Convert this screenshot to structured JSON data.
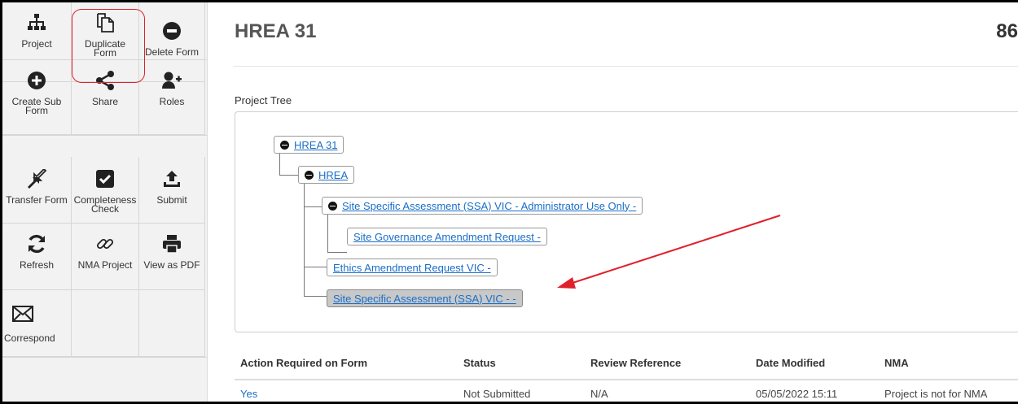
{
  "sidebar": {
    "project": "Project",
    "duplicate": "Duplicate\nForm",
    "delete": "Delete Form",
    "create_sub": "Create Sub\nForm",
    "share": "Share",
    "roles": "Roles",
    "transfer": "Transfer Form",
    "completeness": "Completeness\nCheck",
    "submit": "Submit",
    "refresh": "Refresh",
    "nma_project": "NMA Project",
    "view_pdf": "View as PDF",
    "correspond": "Correspond"
  },
  "header": {
    "title": "HREA 31",
    "number": "86"
  },
  "tree": {
    "label": "Project Tree",
    "nodes": [
      "HREA 31",
      "HREA",
      "Site Specific Assessment (SSA) VIC - Administrator Use Only -",
      "Site Governance Amendment Request -",
      "Ethics Amendment Request VIC -",
      "Site Specific Assessment (SSA) VIC - -"
    ]
  },
  "table": {
    "headers": [
      "Action Required on Form",
      "Status",
      "Review Reference",
      "Date Modified",
      "NMA"
    ],
    "row": [
      "Yes",
      "Not Submitted",
      "N/A",
      "05/05/2022 15:11",
      "Project is not for NMA"
    ]
  },
  "colors": {
    "link": "#1a6ec7",
    "highlight": "#e0202a",
    "sidebar_bg": "#f2f2f2"
  },
  "icons": [
    "sitemap-icon",
    "duplicate-icon",
    "minus-circle-icon",
    "plus-circle-icon",
    "share-icon",
    "add-user-icon",
    "transfer-icon",
    "checkbox-icon",
    "upload-icon",
    "refresh-icon",
    "link-icon",
    "print-icon",
    "envelope-icon"
  ]
}
